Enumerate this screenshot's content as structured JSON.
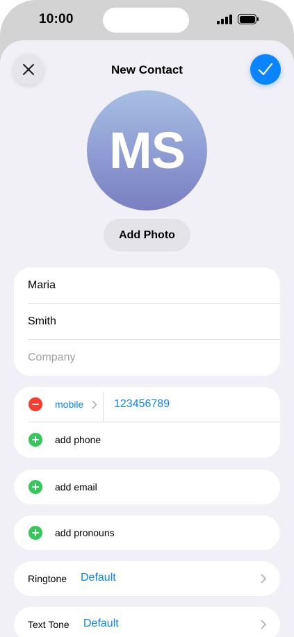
{
  "status_bar": {
    "time": "10:00"
  },
  "nav": {
    "title": "New Contact",
    "close_icon": "xmark-icon",
    "done_icon": "checkmark-icon"
  },
  "contact": {
    "initials": "MS",
    "add_photo_label": "Add Photo",
    "first_name": "Maria",
    "last_name": "Smith",
    "company_placeholder": "Company"
  },
  "phone": {
    "label": "mobile",
    "number": "123456789",
    "add_phone_label": "add phone"
  },
  "add_email_label": "add email",
  "add_pronouns_label": "add pronouns",
  "ringtone": {
    "label": "Ringtone",
    "value": "Default"
  },
  "text_tone": {
    "label": "Text Tone",
    "value": "Default"
  },
  "colors": {
    "accent": "#0a84ff",
    "delete": "#ff3b30",
    "add": "#34c759",
    "background": "#f1f0f6"
  }
}
